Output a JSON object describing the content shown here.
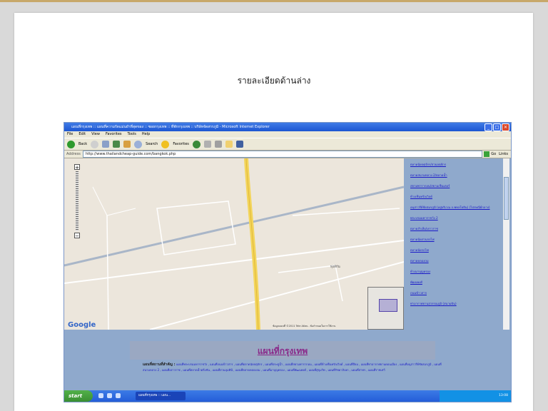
{
  "page": {
    "heading": "รายละเอียดด้านล่าง"
  },
  "browser": {
    "title": "แผนที่กรุงเทพ :: แผนที่ความรัดแม่นยำที่สุดของ :: ซอยกรุงเทพ :: ที่พักกรุงเทพ :: บริษัทจัดสรรภูมิ - Microsoft Internet Explorer",
    "menu": [
      "File",
      "Edit",
      "View",
      "Favorites",
      "Tools",
      "Help"
    ],
    "toolbar": {
      "back": "Back",
      "search": "Search",
      "favorites": "Favorites"
    },
    "address_label": "Address",
    "address_value": "http://www.thailandcheap-guide.com/bangkok.php",
    "go_label": "Go",
    "links_label": "Links"
  },
  "map": {
    "google_logo": "Google",
    "copyright": "ข้อมูลแผนที่ ©2011 Tele Atlas - ข้อกำหนดในการใช้งาน",
    "place_label": "ทุ่งสีกัน"
  },
  "sidebar": {
    "links": [
      "ตลาดนัดจตุจักร/สวนจตุจักร",
      "ตลาดสนามหลวง 2/ตลาดน้ำ",
      "สยามพารากอน/สยามเซ็นเตอร์",
      "ห้างเซ็นทรัลเวิลด์",
      "อนุสาวรีย์ชัยสมรภูมิ (อยู่บริเวณ ถ.พหลโยธิน) (ไปรษณีย์กลาง)",
      "พระบรมมหาราชวัง 2",
      "ตลาดสำเพ็ง/เยาวราช",
      "ตลาดนัดสวนรถไฟ",
      "ตลาดนัดรถไฟ",
      "ตลาดคลองถม",
      "ห้างมาบุญครอง",
      "พัฒนพงศ์",
      "ถนนข้าวสาร",
      "ท่าอากาศยานสุวรรณภูมิ (สนามบิน)"
    ]
  },
  "banner": {
    "title": "แผนที่กรุงเทพ"
  },
  "bottom": {
    "lead": "แผนที่สถานที่สำคัญ :",
    "text": "แผนที่พระบรมมหาราชวัง , แผนที่ถนนข้าวสาร , แผนที่ตลาดนัดจตุจักร , แผนที่ประตูน้ำ , แผนที่สยามพารากอน , แผนที่ห้างเซ็นทรัลเวิลด์ , แผนที่สีลม , แผนที่ท่าอากาศยานดอนเมือง , แผนที่อนุสาวรีย์ชัยสมรภูมิ , แผนที่สนามหลวง 2 , แผนที่เยาวราช , แผนที่ตลาดน้ำตลิ่งชัน , แผนที่สวนลุมพินี , แผนที่ตลาดคลองถม , แผนที่มาบุญครอง , แผนที่พัฒนพงศ์ , แผนที่สุขุมวิท , แผนที่รัชดาภิเษก , แผนที่สาทร , แผนที่ราชเทวี"
  },
  "taskbar": {
    "start": "start",
    "task": "แผนที่กรุงเทพ :: แผน...",
    "clock": "13:08"
  }
}
